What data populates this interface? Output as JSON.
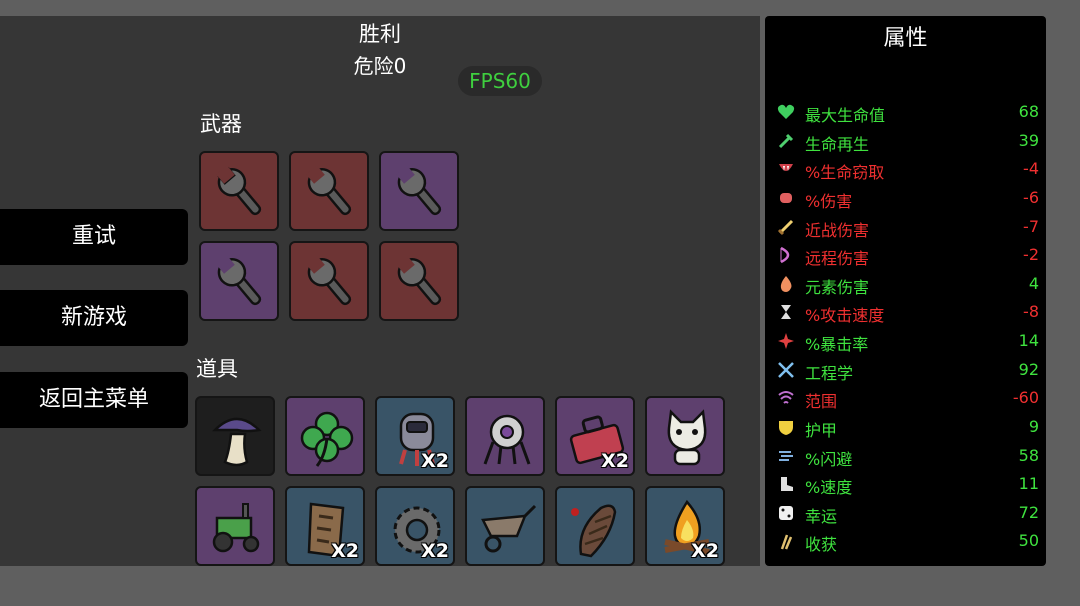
{
  "header": {
    "result": "胜利",
    "danger": "危险0",
    "fps": "FPS60"
  },
  "menu": {
    "retry": "重试",
    "new_game": "新游戏",
    "main_menu": "返回主菜单"
  },
  "weapons": {
    "title": "武器",
    "slots": [
      {
        "icon": "wrench-icon",
        "tier": "red"
      },
      {
        "icon": "wrench-icon",
        "tier": "red"
      },
      {
        "icon": "wrench-icon",
        "tier": "purple"
      },
      {
        "icon": "wrench-icon",
        "tier": "purple"
      },
      {
        "icon": "wrench-icon",
        "tier": "red"
      },
      {
        "icon": "wrench-icon",
        "tier": "red"
      }
    ]
  },
  "items": {
    "title": "道具",
    "slots": [
      {
        "icon": "mushroom-hat-icon",
        "tier": "dark",
        "count": ""
      },
      {
        "icon": "clover-icon",
        "tier": "purple",
        "count": ""
      },
      {
        "icon": "robot-pod-icon",
        "tier": "blue",
        "count": "X2"
      },
      {
        "icon": "turret-icon",
        "tier": "purple",
        "count": ""
      },
      {
        "icon": "toolbox-icon",
        "tier": "purple",
        "count": "X2"
      },
      {
        "icon": "cat-icon",
        "tier": "purple",
        "count": ""
      },
      {
        "icon": "tractor-icon",
        "tier": "purple",
        "count": ""
      },
      {
        "icon": "scroll-icon",
        "tier": "blue",
        "count": "X2"
      },
      {
        "icon": "gear-icon",
        "tier": "blue",
        "count": "X2"
      },
      {
        "icon": "wheelbarrow-icon",
        "tier": "blue",
        "count": ""
      },
      {
        "icon": "larva-icon",
        "tier": "blue",
        "count": ""
      },
      {
        "icon": "campfire-icon",
        "tier": "blue",
        "count": "X2"
      }
    ]
  },
  "stats": {
    "title": "属性",
    "colors": {
      "positive": "#3fe23f",
      "negative": "#ef3030"
    },
    "rows": [
      {
        "icon": "heart-icon",
        "icon_color": "#3fcf5f",
        "label": "最大生命值",
        "value": "68",
        "tone": "pos"
      },
      {
        "icon": "syringe-icon",
        "icon_color": "#4fcf6f",
        "label": "生命再生",
        "value": "39",
        "tone": "pos"
      },
      {
        "icon": "fangs-icon",
        "icon_color": "#d0404a",
        "label": "%生命窃取",
        "value": "-4",
        "tone": "neg"
      },
      {
        "icon": "fist-icon",
        "icon_color": "#e06060",
        "label": "%伤害",
        "value": "-6",
        "tone": "neg"
      },
      {
        "icon": "sword-icon",
        "icon_color": "#f0d070",
        "label": "近战伤害",
        "value": "-7",
        "tone": "neg"
      },
      {
        "icon": "bow-icon",
        "icon_color": "#d070d0",
        "label": "远程伤害",
        "value": "-2",
        "tone": "neg"
      },
      {
        "icon": "flame-icon",
        "icon_color": "#f09060",
        "label": "元素伤害",
        "value": "4",
        "tone": "pos"
      },
      {
        "icon": "hourglass-icon",
        "icon_color": "#e0e0e0",
        "label": "%攻击速度",
        "value": "-8",
        "tone": "neg"
      },
      {
        "icon": "crit-icon",
        "icon_color": "#e04040",
        "label": "%暴击率",
        "value": "14",
        "tone": "pos"
      },
      {
        "icon": "crossed-tools-icon",
        "icon_color": "#80c0f0",
        "label": "工程学",
        "value": "92",
        "tone": "pos"
      },
      {
        "icon": "range-icon",
        "icon_color": "#c070d0",
        "label": "范围",
        "value": "-60",
        "tone": "neg"
      },
      {
        "icon": "shield-icon",
        "icon_color": "#f0d040",
        "label": "护甲",
        "value": "9",
        "tone": "pos"
      },
      {
        "icon": "dodge-icon",
        "icon_color": "#80b0e0",
        "label": "%闪避",
        "value": "58",
        "tone": "pos"
      },
      {
        "icon": "boot-icon",
        "icon_color": "#e0e0e0",
        "label": "%速度",
        "value": "11",
        "tone": "pos"
      },
      {
        "icon": "dice-icon",
        "icon_color": "#f0f0f0",
        "label": "幸运",
        "value": "72",
        "tone": "pos"
      },
      {
        "icon": "wheat-icon",
        "icon_color": "#e0c070",
        "label": "收获",
        "value": "50",
        "tone": "pos"
      }
    ]
  }
}
